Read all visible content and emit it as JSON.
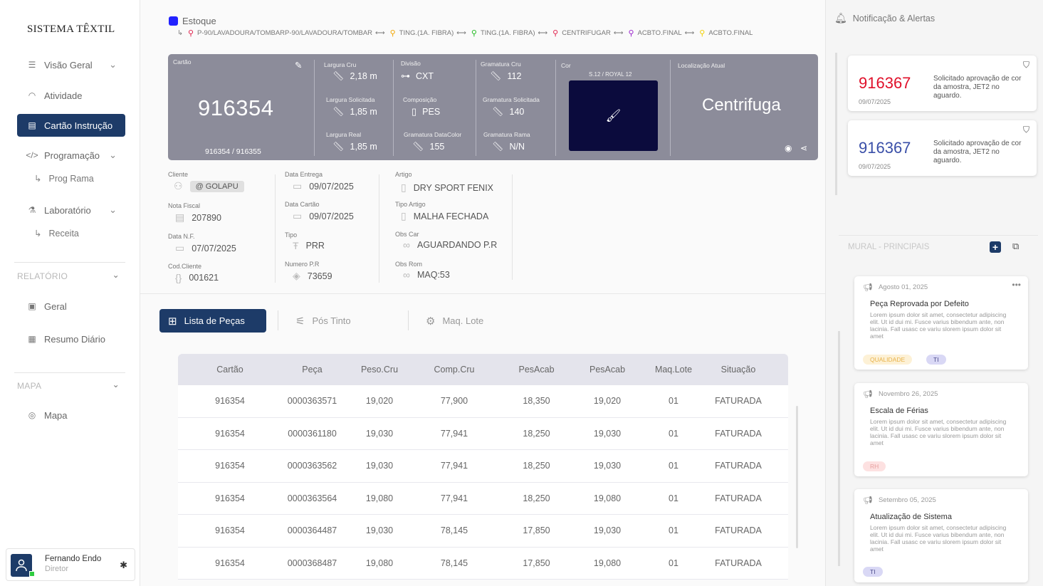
{
  "app": {
    "title": "SISTEMA TÊXTIL"
  },
  "sidebar": {
    "items": [
      {
        "label": "Visão Geral"
      },
      {
        "label": "Atividade"
      },
      {
        "label": "Cartão Instrução"
      },
      {
        "label": "Programação"
      },
      {
        "label": "Prog Rama"
      },
      {
        "label": "Laboratório"
      },
      {
        "label": "Receita"
      }
    ],
    "relatorio": {
      "title": "RELATÓRIO",
      "items": [
        {
          "label": "Geral"
        },
        {
          "label": "Resumo Diário"
        }
      ]
    },
    "mapa": {
      "title": "MAPA",
      "items": [
        {
          "label": "Mapa"
        }
      ]
    },
    "user": {
      "name": "Fernando Endo",
      "role": "Diretor"
    }
  },
  "breadcrumb": {
    "title": "Estoque",
    "steps": [
      {
        "label": "P-90/LAVADOURA/TOMBARP-90/LAVADOURA/TOMBAR",
        "color": "#e0224d"
      },
      {
        "label": "TING.(1A. FIBRA)",
        "color": "#f2a500"
      },
      {
        "label": "TING.(1A. FIBRA)",
        "color": "#22bb22"
      },
      {
        "label": "CENTRIFUGAR",
        "color": "#e0224d"
      },
      {
        "label": "ACBTO.FINAL",
        "color": "#9922cc"
      },
      {
        "label": "ACBTO.FINAL",
        "color": "#f2d000"
      }
    ]
  },
  "card": {
    "cartao_label": "Cartão",
    "cartao": "916354",
    "cartao_sub": "916354 / 916355",
    "largura_cru_label": "Largura Cru",
    "largura_cru": "2,18 m",
    "largura_sol_label": "Largura Solicitada",
    "largura_sol": "1,85 m",
    "largura_real_label": "Largura Real",
    "largura_real": "1,85 m",
    "divisao_label": "Divisão",
    "divisao": "CXT",
    "composicao_label": "Composição",
    "composicao": "PES",
    "gram_datacolor_label": "Gramatura DataColor",
    "gram_datacolor": "155",
    "gram_cru_label": "Gramatura Cru",
    "gram_cru": "112",
    "gram_sol_label": "Gramatura Solicitada",
    "gram_sol": "140",
    "gram_rama_label": "Gramatura Rama",
    "gram_rama": "N/N",
    "cor_label": "Cor",
    "cor_name": "S.12 / ROYAL 12",
    "cor_hex": "#0b0b3d",
    "loc_label": "Localização Atual",
    "loc": "Centrifuga"
  },
  "info": {
    "cliente_label": "Cliente",
    "cliente": "@ GOLAPU",
    "nota_label": "Nota Fiscal",
    "nota": "207890",
    "datanf_label": "Data N.F.",
    "datanf": "07/07/2025",
    "codcli_label": "Cod.Cliente",
    "codcli": "001621",
    "entrega_label": "Data Entrega",
    "entrega": "09/07/2025",
    "datacartao_label": "Data Cartão",
    "datacartao": "09/07/2025",
    "tipo_label": "Tipo",
    "tipo": "PRR",
    "numpr_label": "Numero P.R",
    "numpr": "73659",
    "artigo_label": "Artigo",
    "artigo": "DRY SPORT FENIX",
    "tipoart_label": "Tipo Artigo",
    "tipoart": "MALHA FECHADA",
    "obscar_label": "Obs Car",
    "obscar": "AGUARDANDO P.R",
    "obsrom_label": "Obs Rom",
    "obsrom": "MAQ:53"
  },
  "tabs": [
    {
      "label": "Lista de Peças"
    },
    {
      "label": "Pós Tinto"
    },
    {
      "label": "Maq. Lote"
    }
  ],
  "table": {
    "headers": [
      "Cartão",
      "Peça",
      "Peso.Cru",
      "Comp.Cru",
      "PesAcab",
      "PesAcab",
      "Maq.Lote",
      "Situação"
    ],
    "rows": [
      [
        "916354",
        "0000363571",
        "19,020",
        "77,900",
        "18,350",
        "19,020",
        "01",
        "FATURADA"
      ],
      [
        "916354",
        "0000361180",
        "19,030",
        "77,941",
        "18,250",
        "19,030",
        "01",
        "FATURADA"
      ],
      [
        "916354",
        "0000363562",
        "19,030",
        "77,941",
        "18,250",
        "19,030",
        "01",
        "FATURADA"
      ],
      [
        "916354",
        "0000363564",
        "19,080",
        "77,941",
        "18,250",
        "19,080",
        "01",
        "FATURADA"
      ],
      [
        "916354",
        "0000364487",
        "19,030",
        "78,145",
        "17,850",
        "19,030",
        "01",
        "FATURADA"
      ],
      [
        "916354",
        "0000368487",
        "19,080",
        "78,145",
        "17,850",
        "19,080",
        "01",
        "FATURADA"
      ]
    ]
  },
  "notifications": {
    "title": "Notificação & Alertas",
    "items": [
      {
        "number": "916367",
        "date": "09/07/2025",
        "message": "Solicitado aprovação de cor da amostra, JET2 no aguardo.",
        "color": "#e0102a"
      },
      {
        "number": "916367",
        "date": "09/07/2025",
        "message": "Solicitado aprovação de cor da amostra, JET2 no aguardo.",
        "color": "#3a4fa8"
      }
    ]
  },
  "mural": {
    "title": "MURAL - PRINCIPAIS",
    "posts": [
      {
        "date": "Agosto 01, 2025",
        "title": "Peça Reprovada por Defeito",
        "body": "Lorem ipsum dolor sit amet, consectetur adipiscing elit. Ut id dui mi. Fusce varius bibendum ante, non lacinia. Fall usasc ce variu slorem ipsum dolor sit amet",
        "tags": [
          "QUALIDADE",
          "TI"
        ]
      },
      {
        "date": "Novembro 26, 2025",
        "title": "Escala de Férias",
        "body": "Lorem ipsum dolor sit amet, consectetur adipiscing elit. Ut id dui mi. Fusce varius bibendum ante, non lacinia. Fall usasc ce variu slorem ipsum dolor sit amet",
        "tags": [
          "RH"
        ]
      },
      {
        "date": "Setembro 05, 2025",
        "title": "Atualização de Sistema",
        "body": "Lorem ipsum dolor sit amet, consectetur adipiscing elit. Ut id dui mi. Fusce varius bibendum ante, non lacinia. Fall usasc ce variu slorem ipsum dolor sit amet",
        "tags": [
          "TI"
        ]
      }
    ]
  }
}
